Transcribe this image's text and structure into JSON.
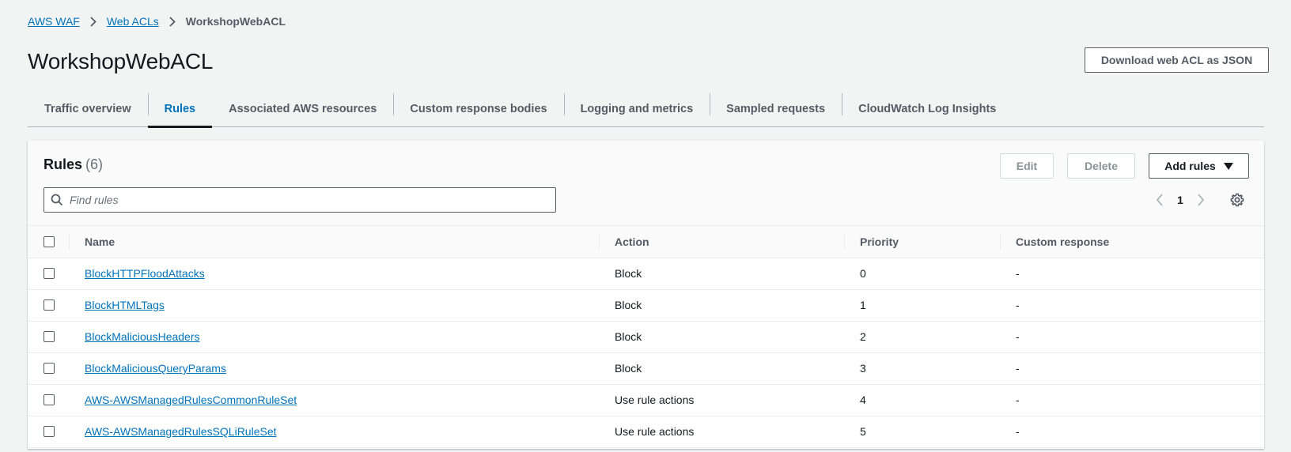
{
  "breadcrumb": {
    "items": [
      {
        "label": "AWS WAF"
      },
      {
        "label": "Web ACLs"
      },
      {
        "label": "WorkshopWebACL"
      }
    ]
  },
  "page": {
    "title": "WorkshopWebACL",
    "download_button": "Download web ACL as JSON"
  },
  "tabs": [
    {
      "label": "Traffic overview"
    },
    {
      "label": "Rules"
    },
    {
      "label": "Associated AWS resources"
    },
    {
      "label": "Custom response bodies"
    },
    {
      "label": "Logging and metrics"
    },
    {
      "label": "Sampled requests"
    },
    {
      "label": "CloudWatch Log Insights"
    }
  ],
  "active_tab": "Rules",
  "rules_panel": {
    "heading": "Rules",
    "count": "(6)",
    "edit_label": "Edit",
    "delete_label": "Delete",
    "add_label": "Add rules",
    "search_placeholder": "Find rules",
    "page_number": "1"
  },
  "table": {
    "columns": [
      "Name",
      "Action",
      "Priority",
      "Custom response"
    ],
    "rows": [
      {
        "name": "BlockHTTPFloodAttacks",
        "action": "Block",
        "priority": "0",
        "custom_response": "-"
      },
      {
        "name": "BlockHTMLTags",
        "action": "Block",
        "priority": "1",
        "custom_response": "-"
      },
      {
        "name": "BlockMaliciousHeaders",
        "action": "Block",
        "priority": "2",
        "custom_response": "-"
      },
      {
        "name": "BlockMaliciousQueryParams",
        "action": "Block",
        "priority": "3",
        "custom_response": "-"
      },
      {
        "name": "AWS-AWSManagedRulesCommonRuleSet",
        "action": "Use rule actions",
        "priority": "4",
        "custom_response": "-"
      },
      {
        "name": "AWS-AWSManagedRulesSQLiRuleSet",
        "action": "Use rule actions",
        "priority": "5",
        "custom_response": "-"
      }
    ]
  },
  "colors": {
    "link": "#0073bb",
    "active_tab_underline": "#16191f",
    "background": "#f2f3f3"
  }
}
